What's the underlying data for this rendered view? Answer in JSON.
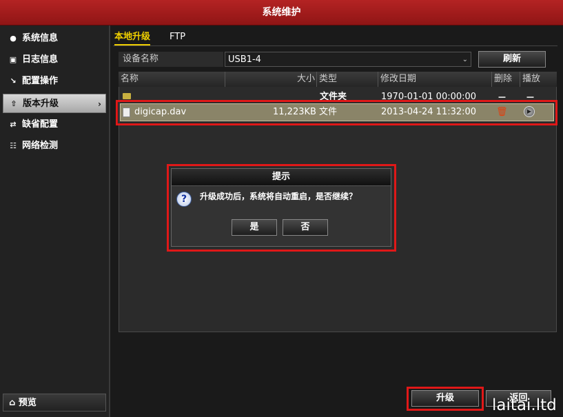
{
  "window": {
    "title": "系统维护"
  },
  "sidebar": {
    "items": [
      {
        "label": "系统信息",
        "icon": "info-icon"
      },
      {
        "label": "日志信息",
        "icon": "log-icon"
      },
      {
        "label": "配置操作",
        "icon": "config-icon"
      },
      {
        "label": "版本升级",
        "icon": "upgrade-icon",
        "active": true
      },
      {
        "label": "缺省配置",
        "icon": "default-icon"
      },
      {
        "label": "网络检测",
        "icon": "network-icon"
      }
    ],
    "preview_label": "预览"
  },
  "tabs": [
    {
      "label": "本地升级",
      "active": true
    },
    {
      "label": "FTP",
      "active": false
    }
  ],
  "device": {
    "label": "设备名称",
    "value": "USB1-4",
    "refresh_label": "刷新"
  },
  "table": {
    "headers": [
      "名称",
      "大小",
      "类型",
      "修改日期",
      "删除",
      "播放"
    ],
    "rows": [
      {
        "name": "",
        "size": "",
        "type": "文件夹",
        "date": "1970-01-01 00:00:00",
        "delete": "－",
        "play": "－"
      },
      {
        "name": "digicap.dav",
        "size": "11,223KB",
        "type": "文件",
        "date": "2013-04-24 11:32:00",
        "selected": true
      }
    ]
  },
  "dialog": {
    "title": "提示",
    "message": "升级成功后，系统将自动重启，是否继续？",
    "yes_label": "是",
    "no_label": "否"
  },
  "footer": {
    "upgrade_label": "升级",
    "back_label": "返回"
  },
  "watermark": "laitai.ltd",
  "colors": {
    "title_bar": "#a01c1c",
    "highlight": "#e01818",
    "active_tab": "#f0d000",
    "selected_row": "#8a8468"
  }
}
